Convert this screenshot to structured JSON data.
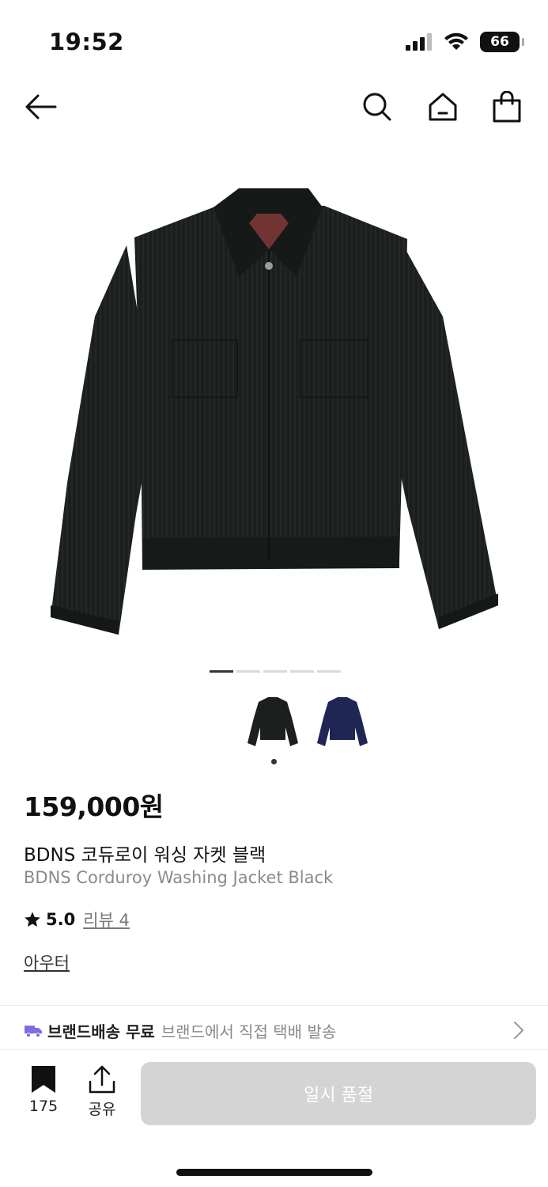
{
  "status_bar": {
    "time": "19:52",
    "battery": "66"
  },
  "product": {
    "price": "159,000원",
    "name_ko": "BDNS 코듀로이 워싱 자켓 블랙",
    "name_en": "BDNS Corduroy Washing Jacket Black",
    "rating": "5.0",
    "review_link": "리뷰 4",
    "category": "아우터",
    "color_options": [
      "black",
      "navy"
    ],
    "image_count": 5,
    "active_image": 1
  },
  "shipping": {
    "label": "브랜드배송 무료",
    "desc": "브랜드에서 직접 택배 발송"
  },
  "bottom_bar": {
    "bookmark_count": "175",
    "share_label": "공유",
    "sold_out_label": "일시 품절"
  },
  "colors": {
    "jacket_black": "#1b1f1e",
    "jacket_navy": "#1f2654",
    "accent_truck": "#7a6ee0",
    "button_disabled": "#d4d4d4"
  }
}
